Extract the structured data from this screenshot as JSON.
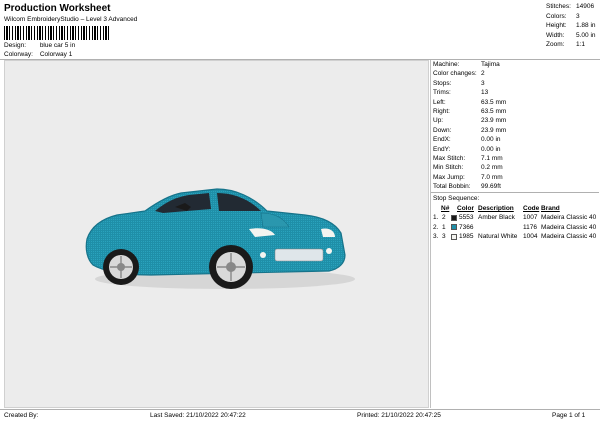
{
  "header": {
    "title": "Production Worksheet",
    "subtitle": "Wilcom EmbroideryStudio – Level 3 Advanced",
    "design_label": "Design:",
    "design_value": "blue car 5 in",
    "colorway_label": "Colorway:",
    "colorway_value": "Colorway 1"
  },
  "stats": [
    {
      "label": "Stitches:",
      "value": "14906"
    },
    {
      "label": "Colors:",
      "value": "3"
    },
    {
      "label": "Height:",
      "value": "1.88 in"
    },
    {
      "label": "Width:",
      "value": "5.00 in"
    },
    {
      "label": "Zoom:",
      "value": "1:1"
    }
  ],
  "machine_info": [
    {
      "label": "Machine:",
      "value": "Tajima"
    },
    {
      "label": "Color changes:",
      "value": "2"
    },
    {
      "label": "Stops:",
      "value": "3"
    },
    {
      "label": "Trims:",
      "value": "13"
    },
    {
      "label": "Left:",
      "value": "63.5 mm"
    },
    {
      "label": "Right:",
      "value": "63.5 mm"
    },
    {
      "label": "Up:",
      "value": "23.9 mm"
    },
    {
      "label": "Down:",
      "value": "23.9 mm"
    },
    {
      "label": "EndX:",
      "value": "0.00 in"
    },
    {
      "label": "EndY:",
      "value": "0.00 in"
    },
    {
      "label": "Max Stitch:",
      "value": "7.1 mm"
    },
    {
      "label": "Min Stitch:",
      "value": "0.2 mm"
    },
    {
      "label": "Max Jump:",
      "value": "7.0 mm"
    },
    {
      "label": "Total Bobbin:",
      "value": "99.69ft"
    }
  ],
  "stop_sequence": {
    "title": "Stop Sequence:",
    "headers": {
      "n": "N#",
      "color": "Color",
      "desc": "Description",
      "code": "Code",
      "brand": "Brand"
    },
    "rows": [
      {
        "idx": "1.",
        "n": "2",
        "swatch": "#1a1a1a",
        "color": "5553",
        "desc": "Amber Black",
        "code": "1007",
        "brand": "Madeira Classic 40"
      },
      {
        "idx": "2.",
        "n": "1",
        "swatch": "#1f8fa8",
        "color": "7366",
        "desc": "",
        "code": "1176",
        "brand": "Madeira Classic 40"
      },
      {
        "idx": "3.",
        "n": "3",
        "swatch": "#f4f4f0",
        "color": "1985",
        "desc": "Natural White",
        "code": "1004",
        "brand": "Madeira Classic 40"
      }
    ]
  },
  "footer": {
    "created_by": "Created By:",
    "last_saved": "Last Saved: 21/10/2022 20:47:22",
    "printed": "Printed: 21/10/2022 20:47:25",
    "page": "Page 1 of 1"
  },
  "colors": {
    "car_body": "#1f8fa8",
    "canvas_bg": "#ececec"
  }
}
